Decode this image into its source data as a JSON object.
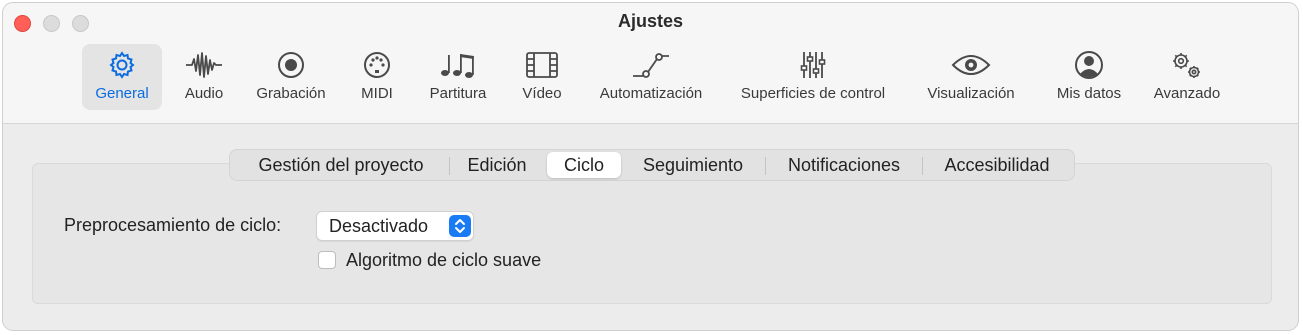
{
  "window": {
    "title": "Ajustes"
  },
  "toolbar": {
    "items": [
      {
        "label": "General",
        "icon": "gear-icon",
        "selected": true
      },
      {
        "label": "Audio",
        "icon": "waveform-icon",
        "selected": false
      },
      {
        "label": "Grabación",
        "icon": "record-icon",
        "selected": false
      },
      {
        "label": "MIDI",
        "icon": "midi-port-icon",
        "selected": false
      },
      {
        "label": "Partitura",
        "icon": "music-notes-icon",
        "selected": false
      },
      {
        "label": "Vídeo",
        "icon": "film-icon",
        "selected": false
      },
      {
        "label": "Automatización",
        "icon": "automation-curve-icon",
        "selected": false
      },
      {
        "label": "Superficies de control",
        "icon": "sliders-icon",
        "selected": false
      },
      {
        "label": "Visualización",
        "icon": "eye-icon",
        "selected": false
      },
      {
        "label": "Mis datos",
        "icon": "person-circle-icon",
        "selected": false
      },
      {
        "label": "Avanzado",
        "icon": "gears-icon",
        "selected": false
      }
    ],
    "accent_color": "#0a6ce0"
  },
  "tabs": {
    "items": [
      {
        "label": "Gestión del proyecto",
        "selected": false
      },
      {
        "label": "Edición",
        "selected": false
      },
      {
        "label": "Ciclo",
        "selected": true
      },
      {
        "label": "Seguimiento",
        "selected": false
      },
      {
        "label": "Notificaciones",
        "selected": false
      },
      {
        "label": "Accesibilidad",
        "selected": false
      }
    ]
  },
  "settings": {
    "preprocessing_label": "Preprocesamiento de ciclo:",
    "preprocessing_value": "Desactivado",
    "smooth_cycle_label": "Algoritmo de ciclo suave",
    "smooth_cycle_checked": false
  }
}
